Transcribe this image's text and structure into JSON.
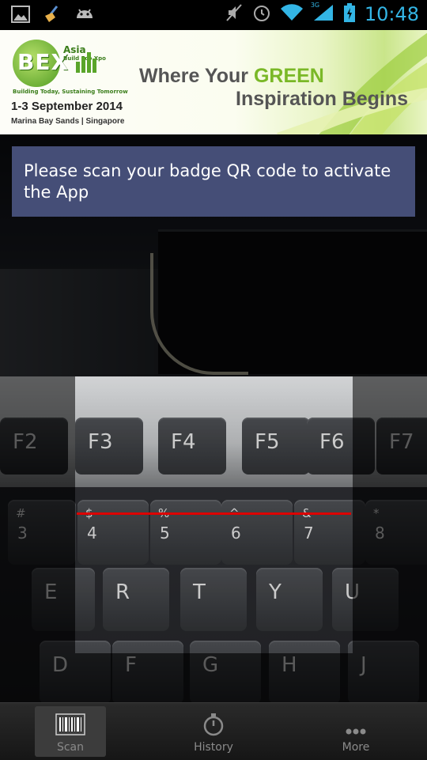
{
  "status_bar": {
    "time": "10:48",
    "network_label": "3G"
  },
  "banner": {
    "logo_text": "BEX",
    "logo_region": "Asia",
    "logo_subtitle": "Build Eco Xpo",
    "logo_tagline": "Building Today, Sustaining Tomorrow",
    "date": "1-3 September 2014",
    "venue": "Marina Bay Sands | Singapore",
    "tagline_part1": "Where Your ",
    "tagline_highlight": "GREEN",
    "tagline_line2": "Inspiration Begins"
  },
  "camera": {
    "keys": [
      {
        "label": "F2"
      },
      {
        "label": "F3"
      },
      {
        "label": "F4"
      },
      {
        "label": "F5"
      },
      {
        "label": "F6"
      },
      {
        "label": "F7"
      },
      {
        "top": "#",
        "bottom": "3"
      },
      {
        "top": "$",
        "bottom": "4"
      },
      {
        "top": "%",
        "bottom": "5"
      },
      {
        "top": "^",
        "bottom": "6"
      },
      {
        "top": "&",
        "bottom": "7"
      },
      {
        "top": "*",
        "bottom": "8"
      },
      {
        "label": "E"
      },
      {
        "label": "R"
      },
      {
        "label": "T"
      },
      {
        "label": "Y"
      },
      {
        "label": "U"
      },
      {
        "label": "D"
      },
      {
        "label": "F"
      },
      {
        "label": "G"
      },
      {
        "label": "H"
      },
      {
        "label": "J"
      }
    ]
  },
  "toast": {
    "message": "Please scan your badge QR code to activate the App"
  },
  "bottom_nav": {
    "items": [
      {
        "label": "Scan",
        "icon": "barcode-icon",
        "selected": true
      },
      {
        "label": "History",
        "icon": "stopwatch-icon",
        "selected": false
      },
      {
        "label": "More",
        "icon": "more-dots-icon",
        "selected": false
      }
    ]
  },
  "colors": {
    "status_clock": "#33b5e5",
    "toast_background": "#454e77",
    "laser_line": "#dd0000",
    "logo_green": "#5aa52a"
  }
}
